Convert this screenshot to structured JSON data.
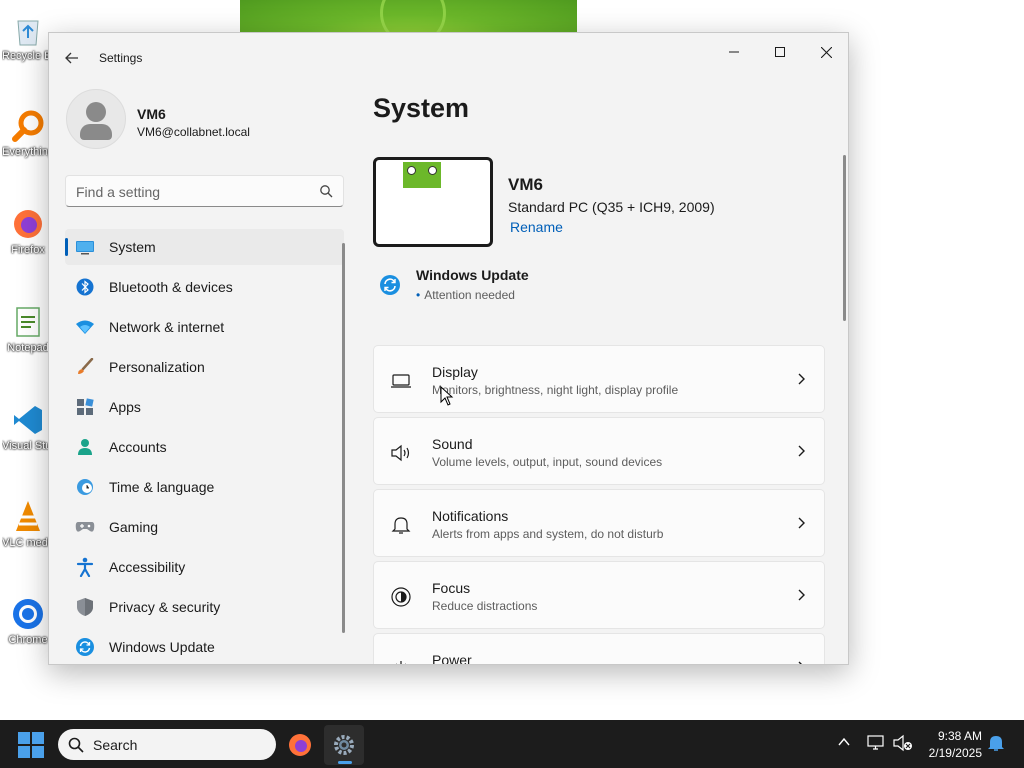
{
  "desktop": {
    "icons": [
      {
        "label": "Recycle Bin",
        "glyph": "recycle-bin-icon"
      },
      {
        "label": "Everything",
        "glyph": "search-magnifier-icon"
      },
      {
        "label": "Firefox",
        "glyph": "firefox-icon"
      },
      {
        "label": "Notepad",
        "glyph": "notepad-icon"
      },
      {
        "label": "Visual Studio Code",
        "glyph": "vscode-icon"
      },
      {
        "label": "VLC media player",
        "glyph": "vlc-icon"
      },
      {
        "label": "Chrome",
        "glyph": "chrome-icon"
      }
    ]
  },
  "window": {
    "app_title": "Settings",
    "back_icon": "back-arrow-icon",
    "controls": {
      "minimize": "minimize-icon",
      "maximize": "maximize-icon",
      "close": "close-icon"
    }
  },
  "user": {
    "name": "VM6",
    "email": "VM6@collabnet.local"
  },
  "search": {
    "placeholder": "Find a setting",
    "value": ""
  },
  "nav": {
    "items": [
      {
        "label": "System",
        "icon": "system-monitor-icon",
        "active": true
      },
      {
        "label": "Bluetooth & devices",
        "icon": "bluetooth-icon"
      },
      {
        "label": "Network & internet",
        "icon": "wifi-icon"
      },
      {
        "label": "Personalization",
        "icon": "brush-icon"
      },
      {
        "label": "Apps",
        "icon": "apps-icon"
      },
      {
        "label": "Accounts",
        "icon": "person-icon"
      },
      {
        "label": "Time & language",
        "icon": "globe-clock-icon"
      },
      {
        "label": "Gaming",
        "icon": "gamepad-icon"
      },
      {
        "label": "Accessibility",
        "icon": "accessibility-icon"
      },
      {
        "label": "Privacy & security",
        "icon": "shield-icon"
      },
      {
        "label": "Windows Update",
        "icon": "update-icon"
      }
    ]
  },
  "main": {
    "title": "System",
    "device": {
      "name": "VM6",
      "model": "Standard PC (Q35 + ICH9, 2009)",
      "rename_label": "Rename"
    },
    "windows_update": {
      "title": "Windows Update",
      "status": "Attention needed"
    },
    "cards": [
      {
        "title": "Display",
        "subtitle": "Monitors, brightness, night light, display profile",
        "icon": "laptop-icon"
      },
      {
        "title": "Sound",
        "subtitle": "Volume levels, output, input, sound devices",
        "icon": "speaker-icon"
      },
      {
        "title": "Notifications",
        "subtitle": "Alerts from apps and system, do not disturb",
        "icon": "bell-icon"
      },
      {
        "title": "Focus",
        "subtitle": "Reduce distractions",
        "icon": "focus-icon"
      },
      {
        "title": "Power",
        "subtitle": "",
        "icon": "power-icon"
      }
    ]
  },
  "taskbar": {
    "search_label": "Search",
    "time": "9:38 AM",
    "date": "2/19/2025"
  },
  "colors": {
    "accent": "#005fb8",
    "window_bg": "#f3f3f3",
    "taskbar_bg": "#1c1c1c"
  }
}
